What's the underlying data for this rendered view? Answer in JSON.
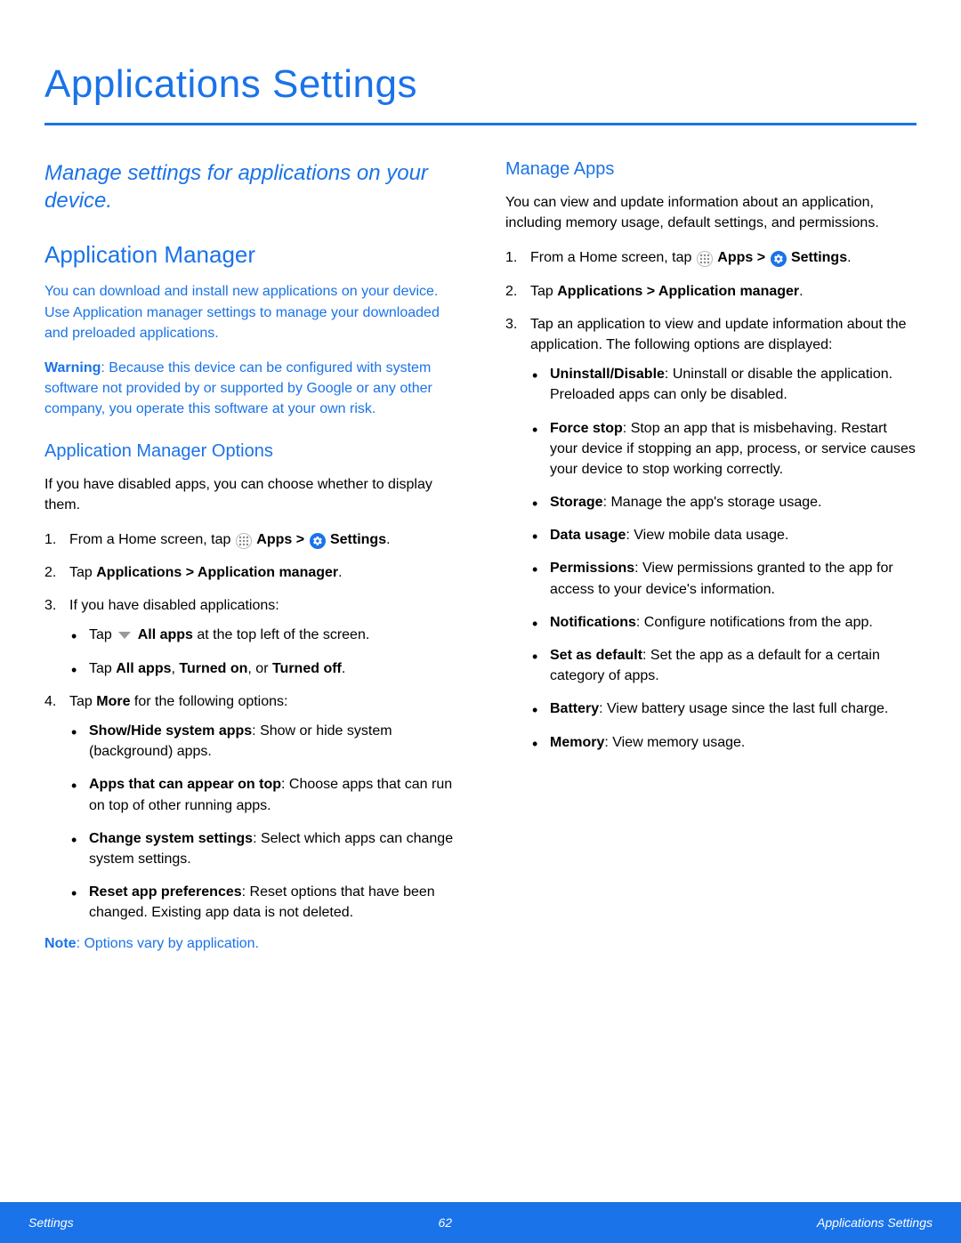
{
  "page": {
    "title": "Applications Settings",
    "intro": "Manage settings for applications on your device."
  },
  "left": {
    "h2": "Application Manager",
    "para1": "You can download and install new applications on your device. Use Application manager settings to manage your downloaded and preloaded applications.",
    "warning_label": "Warning",
    "warning_text": ": Because this device can be configured with system software not provided by or supported by Google or any other company, you operate this software at your own risk.",
    "h3": "Application Manager Options",
    "para2": "If you have disabled apps, you can choose whether to display them.",
    "step1_a": "From a Home screen, tap ",
    "apps_label": "Apps",
    "gt": " > ",
    "settings_label": "Settings",
    "period": ".",
    "step2_a": "Tap ",
    "step2_b": "Applications > Application manager",
    "step3": "If you have disabled applications:",
    "step3_b1_a": "Tap ",
    "step3_b1_b": "All apps",
    "step3_b1_c": " at the top left of the screen.",
    "step3_b2_a": "Tap ",
    "step3_b2_b": "All apps",
    "step3_b2_c": ", ",
    "step3_b2_d": "Turned on",
    "step3_b2_e": ", or ",
    "step3_b2_f": "Turned off",
    "step4_a": "Tap ",
    "step4_b": "More",
    "step4_c": " for the following options:",
    "opt1_a": "Show/Hide system apps",
    "opt1_b": ": Show or hide system (background) apps.",
    "opt2_a": "Apps that can appear on top",
    "opt2_b": ": Choose apps that can run on top of other running apps.",
    "opt3_a": "Change system settings",
    "opt3_b": ": Select which apps can change system settings.",
    "opt4_a": "Reset app preferences",
    "opt4_b": ": Reset options that have been changed. Existing app data is not deleted.",
    "note_label": "Note",
    "note_text": ": Options vary by application."
  },
  "right": {
    "h3": "Manage Apps",
    "para1": "You can view and update information about an application, including memory usage, default settings, and permissions.",
    "step1_a": "From a Home screen, tap ",
    "apps_label": "Apps",
    "gt": " > ",
    "settings_label": "Settings",
    "period": ".",
    "step2_a": "Tap ",
    "step2_b": "Applications > Application manager",
    "step3": "Tap an application to view and update information about the application. The following options are displayed:",
    "b1_a": "Uninstall/Disable",
    "b1_b": ": Uninstall or disable the application. Preloaded apps can only be disabled.",
    "b2_a": "Force stop",
    "b2_b": ": Stop an app that is misbehaving. Restart your device if stopping an app, process, or service causes your device to stop working correctly.",
    "b3_a": "Storage",
    "b3_b": ": Manage the app's storage usage.",
    "b4_a": "Data usage",
    "b4_b": ": View mobile data usage.",
    "b5_a": "Permissions",
    "b5_b": ": View permissions granted to the app for access to your device's information.",
    "b6_a": "Notifications",
    "b6_b": ": Configure notifications from the app.",
    "b7_a": "Set as default",
    "b7_b": ": Set the app as a default for a certain category of apps.",
    "b8_a": "Battery",
    "b8_b": ": View battery usage since the last full charge.",
    "b9_a": "Memory",
    "b9_b": ": View memory usage."
  },
  "footer": {
    "left": "Settings",
    "center": "62",
    "right": "Applications Settings"
  }
}
